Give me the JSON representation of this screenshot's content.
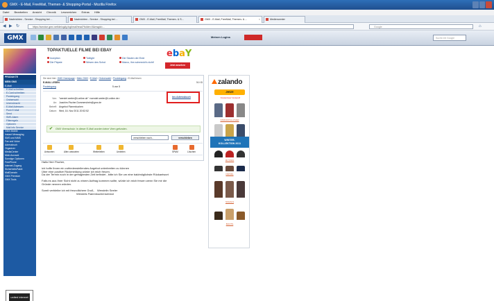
{
  "window": {
    "title": "GMX - E-Mail, FreeMail, Themen- & Shopping-Portal - Mozilla Firefox"
  },
  "menubar": [
    "Datei",
    "Bearbeiten",
    "Ansicht",
    "Chronik",
    "Lesezeichen",
    "Extras",
    "Hilfe"
  ],
  "tabs": [
    {
      "label": "Nachrichten - Service - Shopping bei ..."
    },
    {
      "label": "Nachrichten - Service - Shopping bei ..."
    },
    {
      "label": "GMX - E-Mail, FreeMail, Themen- & S..."
    },
    {
      "label": "GMX - E-Mail, FreeMail, Themen- & ..."
    },
    {
      "label": "Mediencenter"
    }
  ],
  "navbar": {
    "url": "https://service.gmx.net/de/cgi/g.fcgi/mail/read?folder=0&msgid=...",
    "search_placeholder": "Google"
  },
  "gmx": {
    "logo": "GMX",
    "logout": "Meinen Logins",
    "search_placeholder": "Suche mit Google"
  },
  "sidebar": {
    "head1": "PRODUKTE",
    "head2": "MEIN GMX",
    "items": [
      {
        "label": "E-Mail",
        "type": "item"
      },
      {
        "label": "E-Mail schreiben",
        "type": "sub"
      },
      {
        "label": "E-Card schreiben",
        "type": "sub"
      },
      {
        "label": "Posteingang",
        "type": "sub"
      },
      {
        "label": "Ordnerwahl",
        "type": "sub"
      },
      {
        "label": "Unerwünscht",
        "type": "sub"
      },
      {
        "label": "E-Mail Adressen",
        "type": "sub"
      },
      {
        "label": "Push E-Mail",
        "type": "sub"
      },
      {
        "label": "Send",
        "type": "sub"
      },
      {
        "label": "SMS-Alarm",
        "type": "sub"
      },
      {
        "label": "Filterregeln",
        "type": "sub"
      },
      {
        "label": "Optionen",
        "type": "sub"
      },
      {
        "label": "Mail Info Service",
        "type": "sub"
      },
      {
        "label": "GMX Mobile",
        "type": "item"
      },
      {
        "label": "Instant Messaging",
        "type": "item"
      },
      {
        "label": "SMS und MMS",
        "type": "item"
      },
      {
        "label": "Fax und Voice",
        "type": "item"
      },
      {
        "label": "Adressbuch",
        "type": "item"
      },
      {
        "label": "Organizer",
        "type": "item"
      },
      {
        "label": "MediaCenter",
        "type": "item"
      },
      {
        "label": "Mein Account",
        "type": "item"
      },
      {
        "label": "Sonstige Optionen",
        "type": "item"
      },
      {
        "label": "FreePhone",
        "type": "item"
      },
      {
        "label": "Internet-Zugang",
        "type": "item"
      },
      {
        "label": "SicherheitsPaket",
        "type": "item"
      },
      {
        "label": "MailDomain",
        "type": "item"
      },
      {
        "label": "GMX Premium",
        "type": "item"
      },
      {
        "label": "GMX Tools",
        "type": "item"
      }
    ],
    "united": "united internet"
  },
  "ad": {
    "title": "TOPAKTUELLE FILME BEI EBAY",
    "links": [
      "Inception",
      "Twilight",
      "Die Säulen der Erde",
      "Die Päpste",
      "Wesen des Schot",
      "Marco, ihm schmeckt's nicht!"
    ],
    "ebay_button": "Jetzt ansehen"
  },
  "mail": {
    "breadcrumb_prefix": "Sie sind hier:",
    "breadcrumb": [
      "GMX Homepage",
      "Mein GMX",
      "E-Mail",
      "Ordnerwahl",
      "Posteingang",
      "E-Mail lesen"
    ],
    "section": "E-MAIL LESEN",
    "size": "96 KB",
    "folder": "Posteingang",
    "count": "5 von 5",
    "from_label": "Von:",
    "from_value": "\"wendel.seeler@t-online.de\" <wendel.seeler@t-online.de>",
    "to_label": "An:",
    "to_value": "Joachim.Fischer.Dummershein@gmx.de",
    "subject_label": "Betreff:",
    "subject_value": "Angebot Flammkuchen",
    "date_label": "Datum:",
    "date_value": "Wed, 16. Nov 2011 20:52:52",
    "addressbook_link": "ins Adressbuch",
    "safe_text": "GMX Virenschutz: In dieser E-Mail wurden keine Viren gefunden.",
    "move_select": "verschieben nach...",
    "move_button": "verschieben",
    "actions": [
      "Antworten",
      "Allen antworten",
      "Weiterleiten",
      "Umleiten",
      "SPAM",
      "Löschen"
    ]
  },
  "body": {
    "lines": [
      "Hallo Herr Fischer,",
      "",
      "ich hoffe Ihnen ein zufriedenstellendes Angebot unterbreiten zu können",
      "Über eine positive Rückmeldung würde ich mich freuen.",
      "Da der Termin noch in der gefragtesten Zeit befindet , bitte ich Sie um eine baldmöglichste Rückantwort",
      "",
      "Falls es aus Ihrer Sicht nicht zu einem Auftrag kommen sollte, würde ich mich freuen wenn Sie mir die",
      "Gründe nennen würden.",
      "",
      "Somit verbleibe ich mit freundlichem Gruß,    Wendelin Seeler",
      "                                             Wendels Flammkuchenservice"
    ]
  },
  "zalando": {
    "logo": "zalando",
    "jetzt": "Jetzt!",
    "shipping": "Kostenloser Versand!",
    "winter": [
      "WINTER-",
      "KOLLEKTION 2011"
    ],
    "labels": [
      "STRICKPULLOVER",
      "MÜTZEN",
      "DIRNDL",
      "SCHALS",
      "BOOTS"
    ]
  },
  "colors": {
    "gmx_blue": "#1d5aa3",
    "highlight_red": "#e11d1d",
    "zalando_orange": "#ff6900"
  }
}
